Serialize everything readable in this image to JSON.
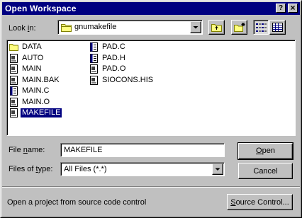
{
  "window": {
    "title": "Open Workspace",
    "help_button": "?",
    "close_button": "×"
  },
  "look_in": {
    "label_pre": "Look ",
    "label_ul": "i",
    "label_post": "n:",
    "value": "gnumakefile"
  },
  "files": [
    {
      "name": "DATA",
      "type": "folder"
    },
    {
      "name": "AUTO",
      "type": "doc"
    },
    {
      "name": "MAIN",
      "type": "doc"
    },
    {
      "name": "MAIN.BAK",
      "type": "doc"
    },
    {
      "name": "MAIN.C",
      "type": "src"
    },
    {
      "name": "MAIN.O",
      "type": "doc"
    },
    {
      "name": "MAKEFILE",
      "type": "doc",
      "selected": true
    },
    {
      "name": "PAD.C",
      "type": "src"
    },
    {
      "name": "PAD.H",
      "type": "src"
    },
    {
      "name": "PAD.O",
      "type": "doc"
    },
    {
      "name": "SIOCONS.HIS",
      "type": "doc"
    }
  ],
  "file_name": {
    "label_pre": "File ",
    "label_ul": "n",
    "label_post": "ame:",
    "value": "MAKEFILE"
  },
  "file_type": {
    "label_pre": "Files of ",
    "label_ul": "t",
    "label_post": "ype:",
    "value": "All Files (*.*)"
  },
  "buttons": {
    "open_ul": "O",
    "open_rest": "pen",
    "cancel": "Cancel",
    "source_ul": "S",
    "source_rest": "ource Control..."
  },
  "status_text": "Open a project from source code control"
}
